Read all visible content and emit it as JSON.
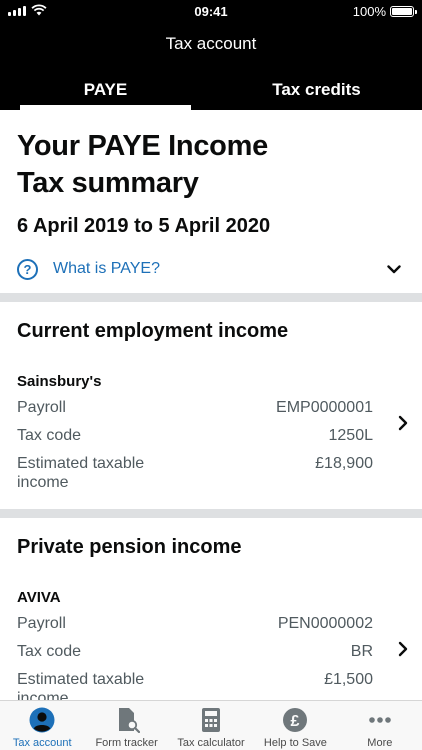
{
  "status_bar": {
    "time": "09:41",
    "battery": "100%"
  },
  "nav": {
    "title": "Tax account",
    "tabs": [
      {
        "label": "PAYE",
        "active": true
      },
      {
        "label": "Tax credits",
        "active": false
      }
    ]
  },
  "summary": {
    "title_line1": "Your PAYE Income",
    "title_line2": "Tax summary",
    "date_range": "6 April 2019 to 5 April 2020",
    "help_link": "What is PAYE?"
  },
  "employment": {
    "heading": "Current employment income",
    "employer": "Sainsbury's",
    "rows": [
      {
        "label": "Payroll",
        "value": "EMP0000001"
      },
      {
        "label": "Tax code",
        "value": "1250L"
      },
      {
        "label": "Estimated taxable income",
        "value": "£18,900"
      }
    ]
  },
  "pension": {
    "heading": "Private pension income",
    "provider": "AVIVA",
    "rows": [
      {
        "label": "Payroll",
        "value": "PEN0000002"
      },
      {
        "label": "Tax code",
        "value": "BR"
      },
      {
        "label": "Estimated taxable income",
        "value": "£1,500"
      }
    ]
  },
  "tab_bar": {
    "items": [
      {
        "label": "Tax account",
        "icon": "person-icon",
        "active": true
      },
      {
        "label": "Form tracker",
        "icon": "document-search-icon",
        "active": false
      },
      {
        "label": "Tax calculator",
        "icon": "calculator-icon",
        "active": false
      },
      {
        "label": "Help to Save",
        "icon": "pound-coin-icon",
        "active": false
      },
      {
        "label": "More",
        "icon": "more-icon",
        "active": false
      }
    ]
  },
  "colors": {
    "accent": "#1d70b8",
    "header": "#000000",
    "divider": "#dee0e2",
    "secondary_text": "#505a5f"
  }
}
